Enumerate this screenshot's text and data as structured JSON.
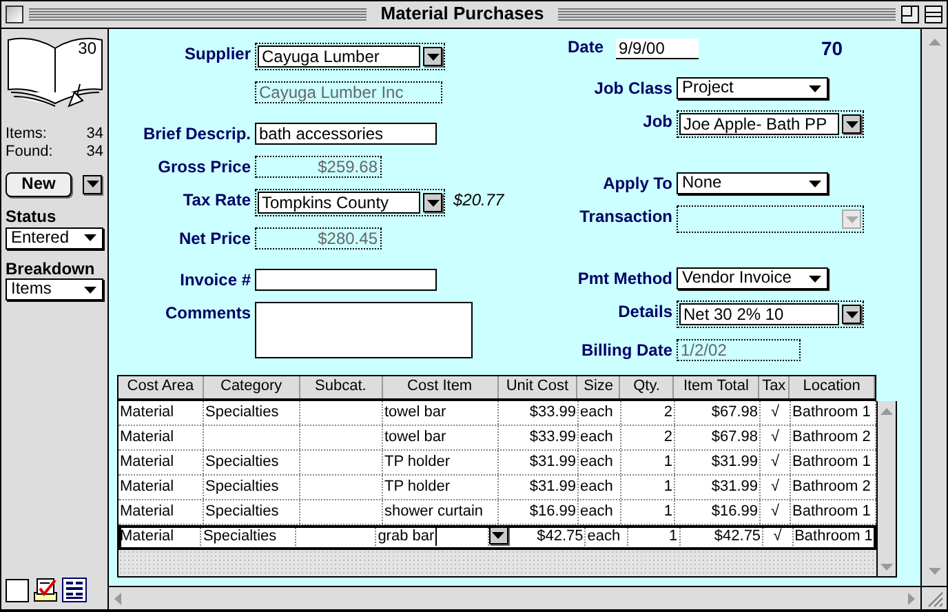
{
  "window": {
    "title": "Material Purchases"
  },
  "sidebar": {
    "record_number": "30",
    "stats": [
      {
        "label": "Items:",
        "value": "34"
      },
      {
        "label": "Found:",
        "value": "34"
      }
    ],
    "new_button": "New",
    "menus": [
      {
        "label": "Status",
        "value": "Entered"
      },
      {
        "label": "Breakdown",
        "value": "Items"
      }
    ]
  },
  "header": {
    "date_label": "Date",
    "date": "9/9/00",
    "record_id": "70"
  },
  "left_groups": [
    [
      {
        "kind": "combo",
        "label": "Supplier",
        "value": "Cayuga Lumber",
        "disabled": false
      },
      {
        "kind": "calc",
        "value": "Cayuga Lumber Inc",
        "disabled": false
      }
    ],
    [
      {
        "kind": "text",
        "label": "Brief Descrip.",
        "value": "bath accessories",
        "disabled": false
      },
      {
        "kind": "amount",
        "label": "Gross Price",
        "value": "$259.68",
        "disabled": false
      },
      {
        "kind": "combo",
        "label": "Tax Rate",
        "value": "Tompkins County",
        "note": "$20.77",
        "disabled": false
      },
      {
        "kind": "amount",
        "label": "Net Price",
        "value": "$280.45",
        "disabled": false
      }
    ],
    [
      {
        "kind": "text",
        "label": "Invoice #",
        "disabled": false
      },
      {
        "kind": "memo",
        "label": "Comments",
        "disabled": false
      }
    ]
  ],
  "right_groups": [
    [
      {
        "kind": "popup",
        "label": "Job Class",
        "value": "Project",
        "disabled": false
      },
      {
        "kind": "combo",
        "label": "Job",
        "value": "Joe Apple- Bath PP",
        "disabled": false
      }
    ],
    [
      {
        "kind": "popup",
        "label": "Apply To",
        "value": "None",
        "disabled": false
      },
      {
        "kind": "combo",
        "label": "Transaction",
        "disabled": true
      }
    ],
    [
      {
        "kind": "popup",
        "label": "Pmt Method",
        "value": "Vendor Invoice",
        "disabled": false
      },
      {
        "kind": "combo",
        "label": "Details",
        "value": "Net 30 2% 10",
        "disabled": false
      },
      {
        "kind": "date",
        "label": "Billing Date",
        "value": "1/2/02",
        "disabled": false
      }
    ]
  ],
  "table": {
    "columns": [
      {
        "label": "Cost Area",
        "kind": "text"
      },
      {
        "label": "Category",
        "kind": "text"
      },
      {
        "label": "Subcat.",
        "kind": "text"
      },
      {
        "label": "Cost Item",
        "kind": "text"
      },
      {
        "label": "Unit Cost",
        "kind": "number"
      },
      {
        "label": "Size",
        "kind": "text"
      },
      {
        "label": "Qty.",
        "kind": "number"
      },
      {
        "label": "Item Total",
        "kind": "number"
      },
      {
        "label": "Tax",
        "kind": "check"
      },
      {
        "label": "Location",
        "kind": "text"
      }
    ],
    "rows": [
      {
        "selected": false,
        "cells": [
          "Material",
          "Specialties",
          null,
          "towel bar",
          "$33.99",
          "each",
          "2",
          "$67.98",
          "√",
          "Bathroom 1"
        ]
      },
      {
        "selected": false,
        "cells": [
          "Material",
          null,
          null,
          "towel bar",
          "$33.99",
          "each",
          "2",
          "$67.98",
          "√",
          "Bathroom 2"
        ]
      },
      {
        "selected": false,
        "cells": [
          "Material",
          "Specialties",
          null,
          "TP holder",
          "$31.99",
          "each",
          "1",
          "$31.99",
          "√",
          "Bathroom 1"
        ]
      },
      {
        "selected": false,
        "cells": [
          "Material",
          "Specialties",
          null,
          "TP holder",
          "$31.99",
          "each",
          "1",
          "$31.99",
          "√",
          "Bathroom 2"
        ]
      },
      {
        "selected": false,
        "cells": [
          "Material",
          "Specialties",
          null,
          "shower curtain",
          "$16.99",
          "each",
          "1",
          "$16.99",
          "√",
          "Bathroom 1"
        ]
      },
      {
        "selected": true,
        "cells": [
          "Material",
          "Specialties",
          null,
          "grab bar",
          "$42.75",
          "each",
          "1",
          "$42.75",
          "√",
          "Bathroom 1"
        ]
      }
    ]
  }
}
